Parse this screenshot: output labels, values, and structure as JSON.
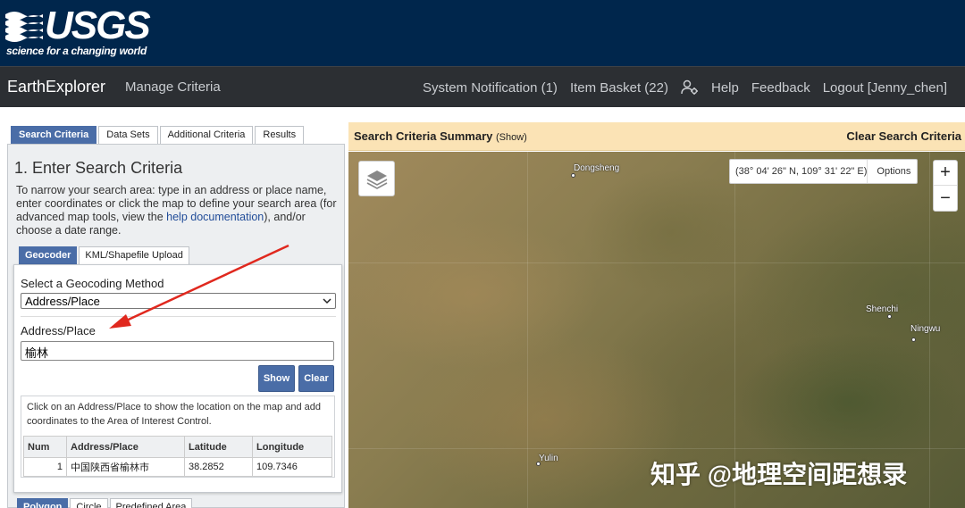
{
  "header": {
    "logo_text": "USGS",
    "tagline": "science for a changing world"
  },
  "nav": {
    "brand": "EarthExplorer",
    "manage": "Manage Criteria",
    "system_notification": "System Notification (1)",
    "item_basket": "Item Basket (22)",
    "user_icon": "user-gear-icon",
    "help": "Help",
    "feedback": "Feedback",
    "logout": "Logout [Jenny_chen]"
  },
  "tabs": [
    {
      "label": "Search Criteria",
      "active": true
    },
    {
      "label": "Data Sets",
      "active": false
    },
    {
      "label": "Additional Criteria",
      "active": false
    },
    {
      "label": "Results",
      "active": false
    }
  ],
  "panel": {
    "title": "1. Enter Search Criteria",
    "desc_before": "To narrow your search area: type in an address or place name, enter coordinates or click the map to define your search area (for advanced map tools, view the ",
    "desc_link": "help documentation",
    "desc_after": "), and/or choose a date range."
  },
  "subtabs": [
    {
      "label": "Geocoder",
      "active": true
    },
    {
      "label": "KML/Shapefile Upload",
      "active": false
    }
  ],
  "geocoder": {
    "method_label": "Select a Geocoding Method",
    "method_value": "Address/Place",
    "address_label": "Address/Place",
    "address_value": "榆林",
    "show_button": "Show",
    "clear_button": "Clear",
    "info_text": "Click on an Address/Place to show the location on the map and add coordinates to the Area of Interest Control.",
    "table": {
      "headers": [
        "Num",
        "Address/Place",
        "Latitude",
        "Longitude"
      ],
      "rows": [
        {
          "num": "1",
          "place": "中国陕西省榆林市",
          "lat": "38.2852",
          "lon": "109.7346"
        }
      ]
    }
  },
  "bottom_tabs": [
    {
      "label": "Polygon",
      "active": true
    },
    {
      "label": "Circle",
      "active": false
    },
    {
      "label": "Predefined Area",
      "active": false
    }
  ],
  "map": {
    "summary_title": "Search Criteria Summary",
    "summary_show": "(Show)",
    "clear_label": "Clear Search Criteria",
    "coordinates": "(38° 04' 26\" N, 109° 31' 22\" E)",
    "options": "Options",
    "zoom_in": "+",
    "zoom_out": "−",
    "cities": {
      "dongsheng": "Dongsheng",
      "shenchi": "Shenchi",
      "ningwu": "Ningwu",
      "yulin": "Yulin"
    },
    "watermark": "知乎 @地理空间距想录"
  },
  "colors": {
    "header_bg": "#00264c",
    "nav_bg": "#2c2f33",
    "accent": "#4a6da7",
    "summary_bg": "#fbe3b5",
    "arrow": "#e0281e"
  }
}
